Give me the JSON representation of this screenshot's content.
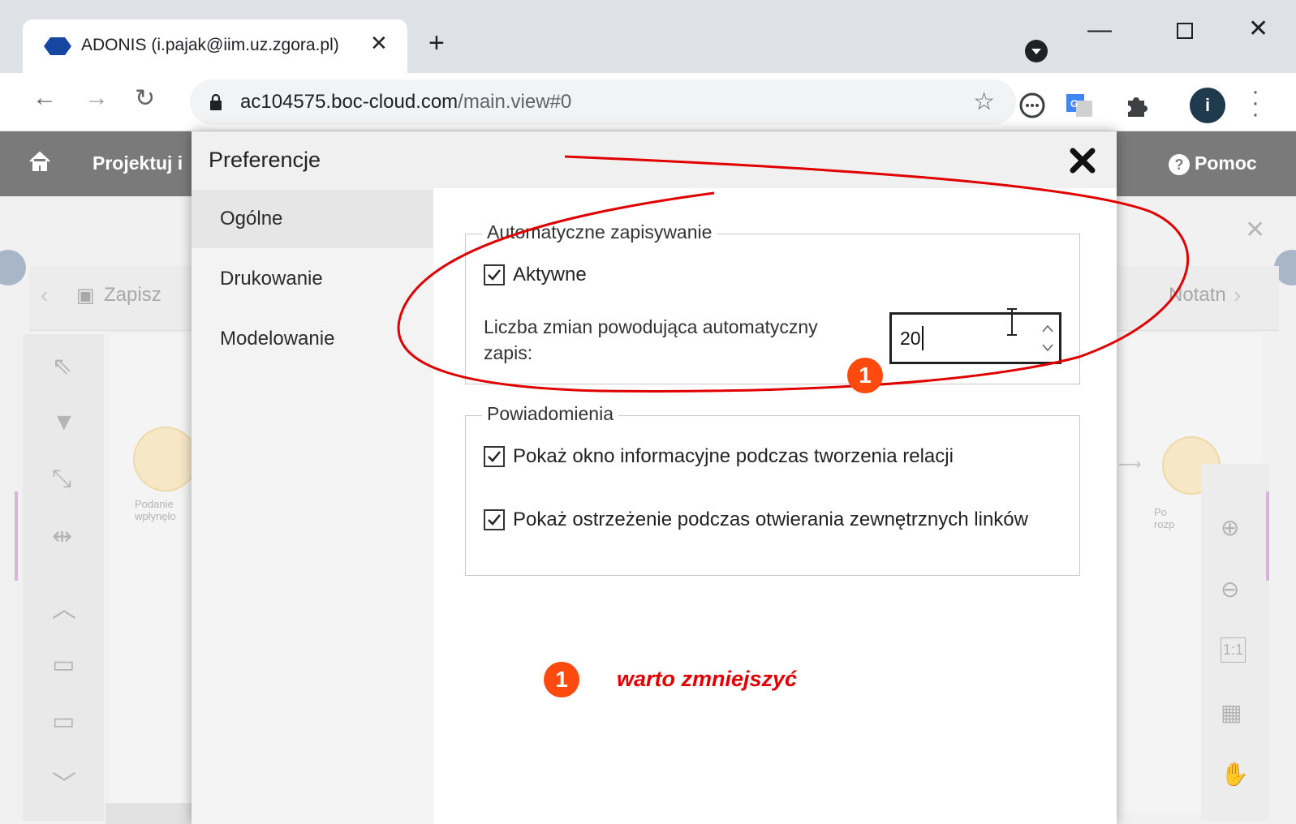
{
  "browser": {
    "tab_title": "ADONIS (i.pajak@iim.uz.zgora.pl)",
    "tab_close": "✕",
    "new_tab": "+",
    "url_host": "ac104575.boc-cloud.com",
    "url_path": "/main.view#0",
    "profile_initial": "i",
    "accent": "#5f6368"
  },
  "app": {
    "menu_label": "Projektuj i",
    "help_label": "Pomoc",
    "save_label": "Zapisz",
    "notes_label": "Notatn",
    "node_left_label": "Podanie\nwpłynęło",
    "node_right_label": "Po\nrozp",
    "zoom_fit_label": "1:1"
  },
  "dialog": {
    "title": "Preferencje",
    "nav": [
      {
        "label": "Ogólne",
        "active": true
      },
      {
        "label": "Drukowanie",
        "active": false
      },
      {
        "label": "Modelowanie",
        "active": false
      }
    ],
    "autosave": {
      "legend": "Automatyczne zapisywanie",
      "active_label": "Aktywne",
      "active_checked": true,
      "changes_label": "Liczba zmian powodująca automatyczny zapis:",
      "changes_value": "20"
    },
    "notifications": {
      "legend": "Powiadomienia",
      "items": [
        {
          "label": "Pokaż okno informacyjne podczas tworzenia relacji",
          "checked": true
        },
        {
          "label": "Pokaż ostrzeżenie podczas otwierania zewnętrznych linków",
          "checked": true
        }
      ]
    }
  },
  "annotations": {
    "badge_number": "1",
    "note_text": "warto zmniejszyć",
    "color": "#e00000"
  }
}
